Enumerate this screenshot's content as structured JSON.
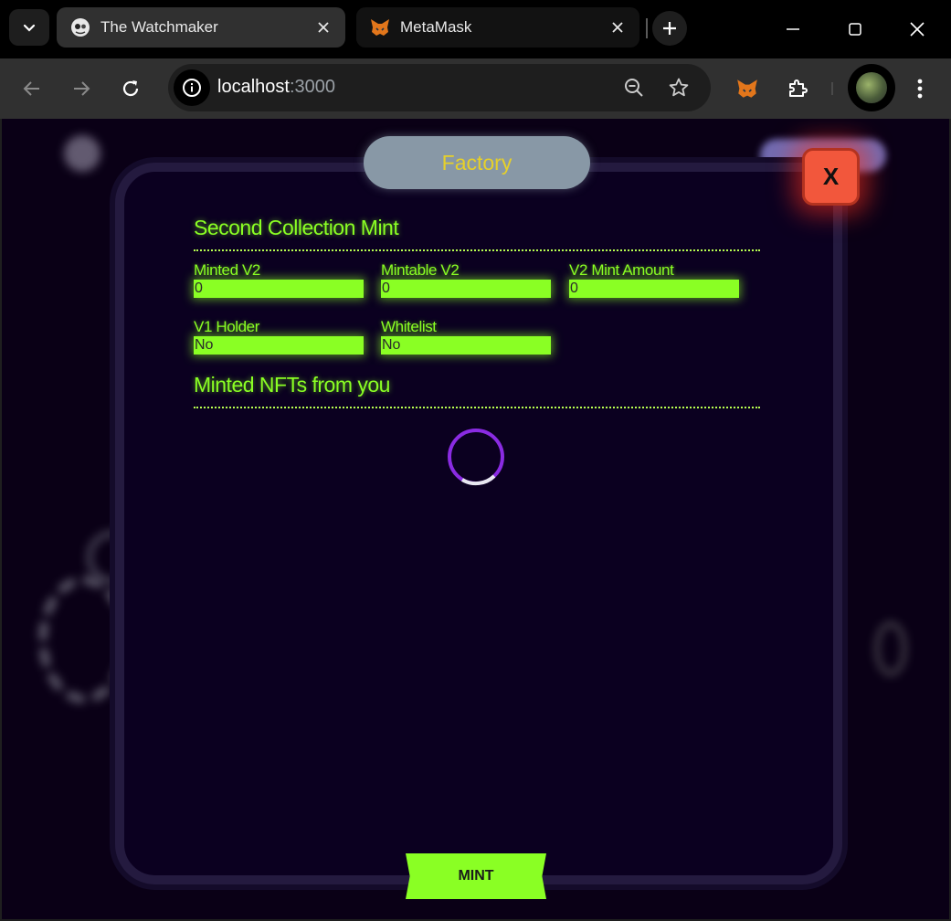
{
  "browser": {
    "tabs": [
      {
        "title": "The Watchmaker",
        "active": true
      },
      {
        "title": "MetaMask",
        "active": false
      }
    ],
    "url_host": "localhost",
    "url_port": ":3000"
  },
  "modal": {
    "header_tab": "Factory",
    "close_label": "X",
    "section_mint_title": "Second Collection Mint",
    "fields": [
      {
        "label": "Minted V2",
        "value": "0"
      },
      {
        "label": "Mintable V2",
        "value": "0"
      },
      {
        "label": "V2 Mint Amount",
        "value": "0"
      },
      {
        "label": "V1 Holder",
        "value": "No"
      },
      {
        "label": "Whitelist",
        "value": "No"
      }
    ],
    "section_nfts_title": "Minted NFTs from you",
    "mint_label": "MINT"
  },
  "colors": {
    "accent_green": "#8aff24",
    "background": "#0a0016",
    "close_red": "#f2573c",
    "spinner_purple": "#8a2be2"
  }
}
